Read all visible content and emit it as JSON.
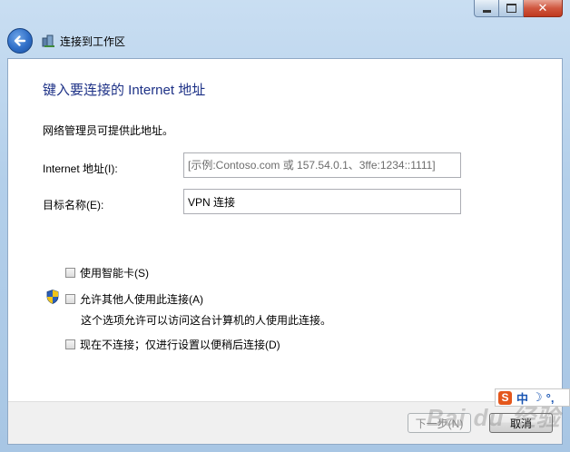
{
  "window": {
    "title": "连接到工作区",
    "caption_buttons": {
      "minimize": "minimize",
      "maximize": "maximize",
      "close": "✕"
    }
  },
  "page": {
    "header": "键入要连接的 Internet 地址",
    "intro": "网络管理员可提供此地址。",
    "internet_address": {
      "label": "Internet 地址(I):",
      "value": "",
      "placeholder": "[示例:Contoso.com 或 157.54.0.1、3ffe:1234::1111]"
    },
    "destination_name": {
      "label": "目标名称(E):",
      "value": "VPN 连接"
    },
    "options": [
      {
        "label": "使用智能卡(S)",
        "checked": false
      },
      {
        "label": "允许其他人使用此连接(A)",
        "checked": false,
        "description": "这个选项允许可以访问这台计算机的人使用此连接。"
      },
      {
        "label": "现在不连接；仅进行设置以便稍后连接(D)",
        "checked": false
      }
    ]
  },
  "footer": {
    "next_label": "下一步(N)",
    "next_enabled": false,
    "cancel_label": "取消"
  },
  "ime": {
    "logo": "S",
    "mode": "中",
    "moon": "☽",
    "punctuation": "°,"
  },
  "watermark": "Bai du 经验",
  "colors": {
    "header_blue": "#1e3287",
    "frame": "#b3cfea",
    "close_red": "#c0391f",
    "ime_orange": "#e4571c"
  }
}
